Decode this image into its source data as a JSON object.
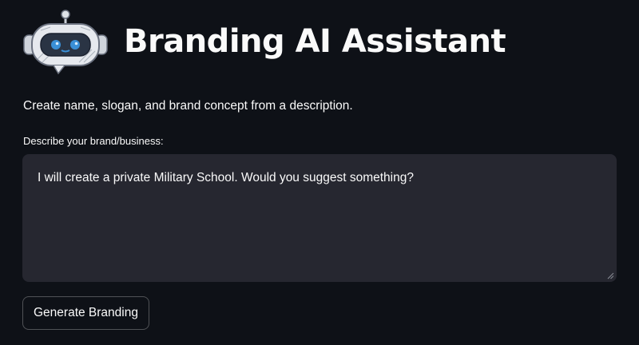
{
  "header": {
    "logo_icon": "robot-icon",
    "title": "Branding AI Assistant"
  },
  "subtitle": "Create name, slogan, and brand concept from a description.",
  "form": {
    "label": "Describe your brand/business:",
    "value": "I will create a private Military School. Would you suggest something?"
  },
  "actions": {
    "generate_label": "Generate Branding"
  },
  "colors": {
    "background": "#0e1117",
    "input_background": "#262730",
    "text": "#fafafa",
    "robot_eye": "#3a8fd6"
  }
}
